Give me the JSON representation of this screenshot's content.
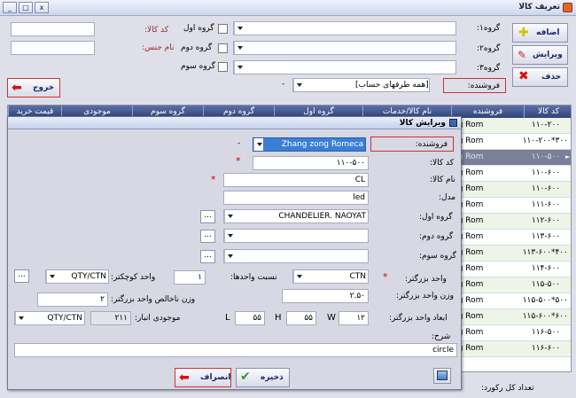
{
  "window": {
    "title": "تعریف کالا",
    "minimize": "_",
    "restore": "□",
    "close": "x"
  },
  "toolbar": {
    "add": "اضافه",
    "edit": "ویرایش",
    "delete": "حذف",
    "exit": "خروج"
  },
  "filters": {
    "group1_label": "گروه۱:",
    "group2_label": "گروه۲:",
    "group3_label": "گروه۳:",
    "seller_label": "فروشنده:",
    "seller_value": "[همه طرفهای حساب]",
    "dash": "-",
    "code_label": "کد کالا:",
    "name_label": "نام جنس:",
    "chk_group1": "گروه اول",
    "chk_group2": "گروه دوم",
    "chk_group3": "گروه سوم"
  },
  "grid": {
    "headers": [
      "کد کالا",
      "فروشنده",
      "نام کالا/خدمات",
      "گروه اول",
      "گروه دوم",
      "گروه سوم",
      "موجودی",
      "قیمت خرید"
    ],
    "rows": [
      {
        "code": "۱۱۰-۲۰۰",
        "seller": "ng Rom"
      },
      {
        "code": "۳۰۰*۱۱۰-۲۰۰",
        "seller": "ng Rom"
      },
      {
        "code": "۱۱۰-۵۰۰",
        "seller": "ng Rom"
      },
      {
        "code": "۱۱۰-۶۰۰",
        "seller": "ng Rom"
      },
      {
        "code": "۱۱۰-۶۰۰",
        "seller": "ng Rom"
      },
      {
        "code": "۱۱۱-۶۰۰",
        "seller": "ng Rom"
      },
      {
        "code": "۱۱۲-۶۰۰",
        "seller": "ng Rom"
      },
      {
        "code": "۱۱۳-۶۰۰",
        "seller": "ng Rom"
      },
      {
        "code": "۴۰۰*۱۱۳-۶۰۰",
        "seller": "ng Rom"
      },
      {
        "code": "۱۱۴-۶۰۰",
        "seller": "ng Rom"
      },
      {
        "code": "۱۱۵-۵۰۰",
        "seller": "ng Rom"
      },
      {
        "code": "۵۰۰*۱۱۵-۵۰۰",
        "seller": "ng Rom"
      },
      {
        "code": "۶۰۰*۱۱۵-۶۰۰",
        "seller": "ng Rom"
      },
      {
        "code": "۱۱۶-۵۰۰",
        "seller": "ng Rom"
      },
      {
        "code": "۱۱۶-۶۰۰",
        "seller": "ng Rom"
      }
    ],
    "row_pointer": "►",
    "footer_count_label": "تعداد کل رکورد:"
  },
  "dialog": {
    "title": "ویرایش کالا",
    "seller_label": "فروشنده:",
    "seller_value": "Zhang zong Romeca",
    "seller_dash": "-",
    "code_label": "کد کالا:",
    "code_value": "۱۱۰-۵۰۰",
    "req": "*",
    "name_label": "نام کالا:",
    "name_value": "CL",
    "model_label": "مدل:",
    "model_value": "led",
    "group1_label": "گروه اول:",
    "group1_value": "CHANDELIER. NAOYAT",
    "group2_label": "گروه دوم:",
    "group2_value": "",
    "group3_label": "گروه سوم:",
    "group3_value": "",
    "dots": "...",
    "big_unit_label": "واحد بزرگتر:",
    "big_unit_value": "CTN",
    "ratio_label": "نسبت واحدها:",
    "ratio_value": "۱",
    "small_unit_label": "واحد کوچکتر:",
    "small_unit_value": "QTY/CTN",
    "weight_label": "وزن واحد بزرگتر:",
    "weight_value": "۲.۵۰",
    "net_weight_label": "وزن ناخالص واحد بزرگتر:",
    "net_weight_value": "۲",
    "dims_label": "ابعاد واحد بزرگتر:",
    "w_label": "W",
    "w_value": "۱۲",
    "h_label": "H",
    "h_value": "۵۵",
    "l_label": "L",
    "l_value": "۵۵",
    "stock_label": "موجودی انبار:",
    "stock_value": "۲۱۱",
    "stock_unit": "QTY/CTN",
    "desc_label": "شرح:",
    "desc_value": "circle",
    "save": "ذخیره",
    "cancel": "انصراف"
  }
}
